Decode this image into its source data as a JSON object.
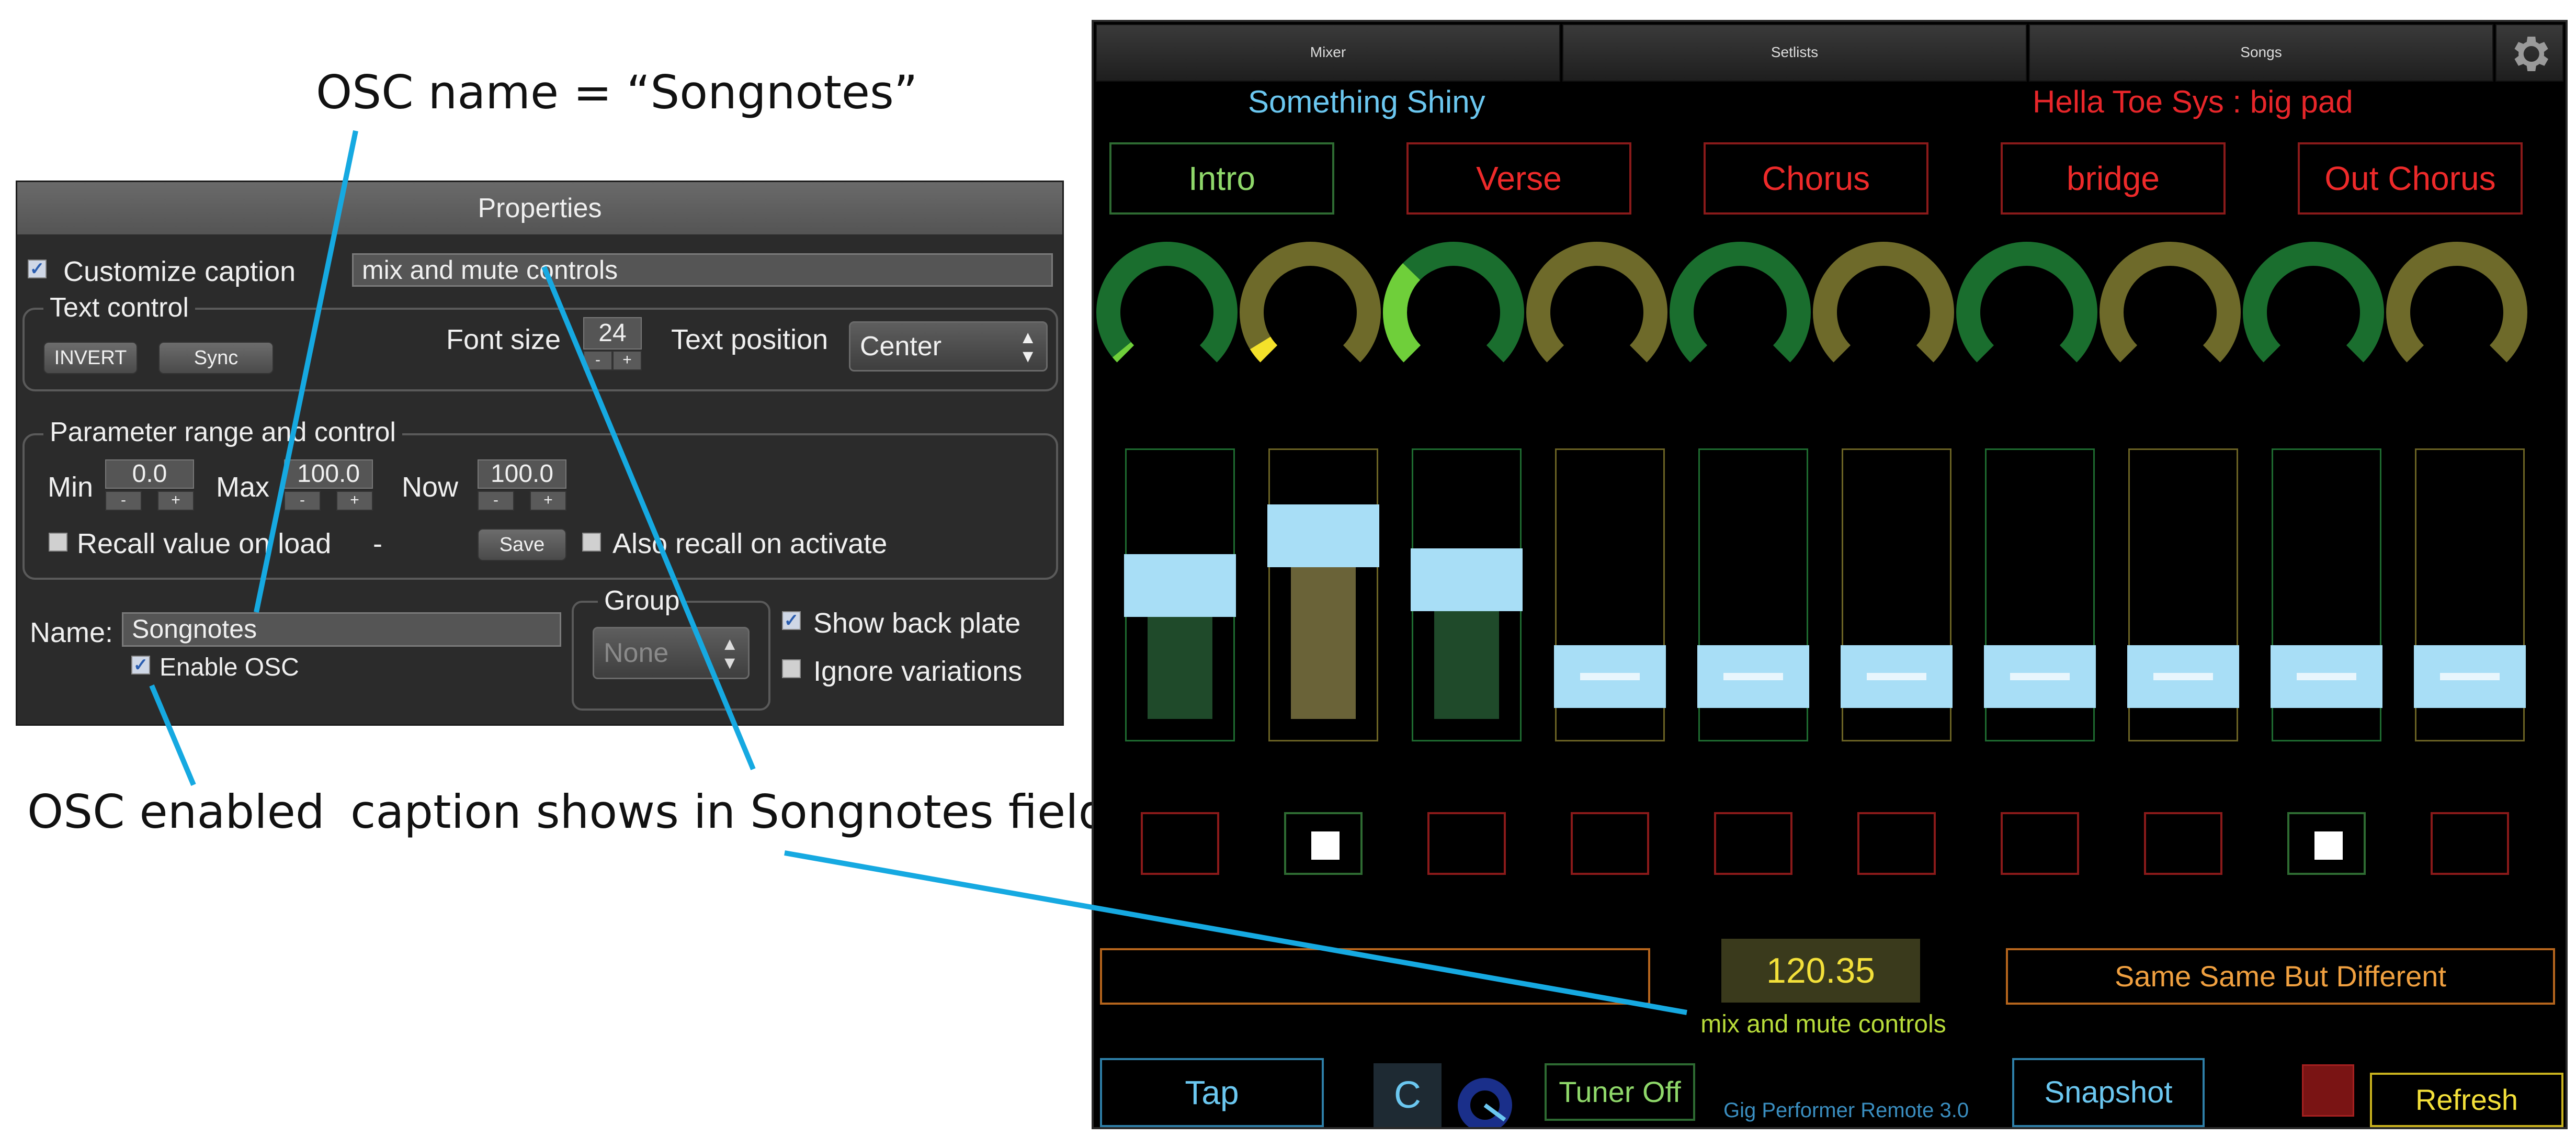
{
  "annotations": {
    "osc_name": "OSC name = “Songnotes”",
    "osc_enabled": "OSC enabled",
    "caption_shows": "caption shows in Songnotes field"
  },
  "properties": {
    "title": "Properties",
    "customize_caption": {
      "label": "Customize caption",
      "checked": true,
      "value": "mix and mute controls"
    },
    "text_control": {
      "label": "Text control",
      "invert_label": "INVERT",
      "sync_label": "Sync",
      "font_size_label": "Font size",
      "font_size": "24",
      "text_position_label": "Text position",
      "text_position": "Center"
    },
    "param_range": {
      "label": "Parameter range and control",
      "min_label": "Min",
      "min": "0.0",
      "max_label": "Max",
      "max": "100.0",
      "now_label": "Now",
      "now": "100.0",
      "recall_label": "Recall value on load",
      "recall_value": "-",
      "save_label": "Save",
      "also_recall_label": "Also recall on activate"
    },
    "name_label": "Name:",
    "name_value": "Songnotes",
    "enable_osc_label": "Enable OSC",
    "group_label": "Group",
    "group_value": "None",
    "show_back_plate_label": "Show back plate",
    "ignore_variations_label": "Ignore variations",
    "plus_label": "+",
    "minus_label": "-"
  },
  "remote": {
    "tabs": [
      "Mixer",
      "Setlists",
      "Songs"
    ],
    "song_title": "Something Shiny",
    "rackspace": "Hella Toe Sys : big pad",
    "song_parts": [
      {
        "label": "Intro",
        "active": true
      },
      {
        "label": "Verse",
        "active": false
      },
      {
        "label": "Chorus",
        "active": false
      },
      {
        "label": "bridge",
        "active": false
      },
      {
        "label": "Out Chorus",
        "active": false
      }
    ],
    "knobs": [
      {
        "color": "#1a6e2e",
        "value": 0.02,
        "indicator": "#6fcf3a"
      },
      {
        "color": "#6e6a2a",
        "value": 0.05,
        "indicator": "#f4e12a"
      },
      {
        "color": "#1a6e2e",
        "value": 0.33,
        "indicator": "#6fcf3a"
      },
      {
        "color": "#6e6a2a",
        "value": 0,
        "indicator": ""
      },
      {
        "color": "#1a6e2e",
        "value": 0,
        "indicator": ""
      },
      {
        "color": "#6e6a2a",
        "value": 0,
        "indicator": ""
      },
      {
        "color": "#1a6e2e",
        "value": 0,
        "indicator": ""
      },
      {
        "color": "#6e6a2a",
        "value": 0,
        "indicator": ""
      },
      {
        "color": "#1a6e2e",
        "value": 0,
        "indicator": ""
      },
      {
        "color": "#6e6a2a",
        "value": 0,
        "indicator": ""
      }
    ],
    "faders": [
      {
        "border": "#1e6b30",
        "value": 0.43,
        "under": "#1f4a2a"
      },
      {
        "border": "#6b6324",
        "value": 0.6,
        "under": "#6a6338"
      },
      {
        "border": "#1e6b30",
        "value": 0.45,
        "under": "#1f4a2a"
      },
      {
        "border": "#6b6324",
        "value": 0.12,
        "under": ""
      },
      {
        "border": "#1e6b30",
        "value": 0.12,
        "under": ""
      },
      {
        "border": "#6b6324",
        "value": 0.12,
        "under": ""
      },
      {
        "border": "#1e6b30",
        "value": 0.12,
        "under": ""
      },
      {
        "border": "#6b6324",
        "value": 0.12,
        "under": ""
      },
      {
        "border": "#1e6b30",
        "value": 0.12,
        "under": ""
      },
      {
        "border": "#6b6324",
        "value": 0.12,
        "under": ""
      }
    ],
    "mutes": [
      {
        "border": "#8a1a1a",
        "on": false
      },
      {
        "border": "#2e6b32",
        "on": true
      },
      {
        "border": "#8a1a1a",
        "on": false
      },
      {
        "border": "#8a1a1a",
        "on": false
      },
      {
        "border": "#8a1a1a",
        "on": false
      },
      {
        "border": "#8a1a1a",
        "on": false
      },
      {
        "border": "#8a1a1a",
        "on": false
      },
      {
        "border": "#8a1a1a",
        "on": false
      },
      {
        "border": "#2e6b32",
        "on": true
      },
      {
        "border": "#8a1a1a",
        "on": false
      }
    ],
    "tempo": "120.35",
    "song_name": "Same Same But Different",
    "caption": "mix and mute controls",
    "tap_label": "Tap",
    "key_label": "C",
    "tuner_label": "Tuner Off",
    "version_label": "Gig Performer Remote 3.0",
    "snapshot_label": "Snapshot",
    "refresh_label": "Refresh"
  },
  "colors": {
    "annotation_line": "#16a9e1",
    "song_title": "#6bc7f0",
    "rackspace": "#e8262a",
    "part_active": "#8fd86a",
    "part_inactive": "#ee2a2a",
    "tempo": "#f3e03a",
    "song_name": "#f0a040",
    "caption": "#b8dc3a",
    "fader_fill": "#a8def6"
  }
}
